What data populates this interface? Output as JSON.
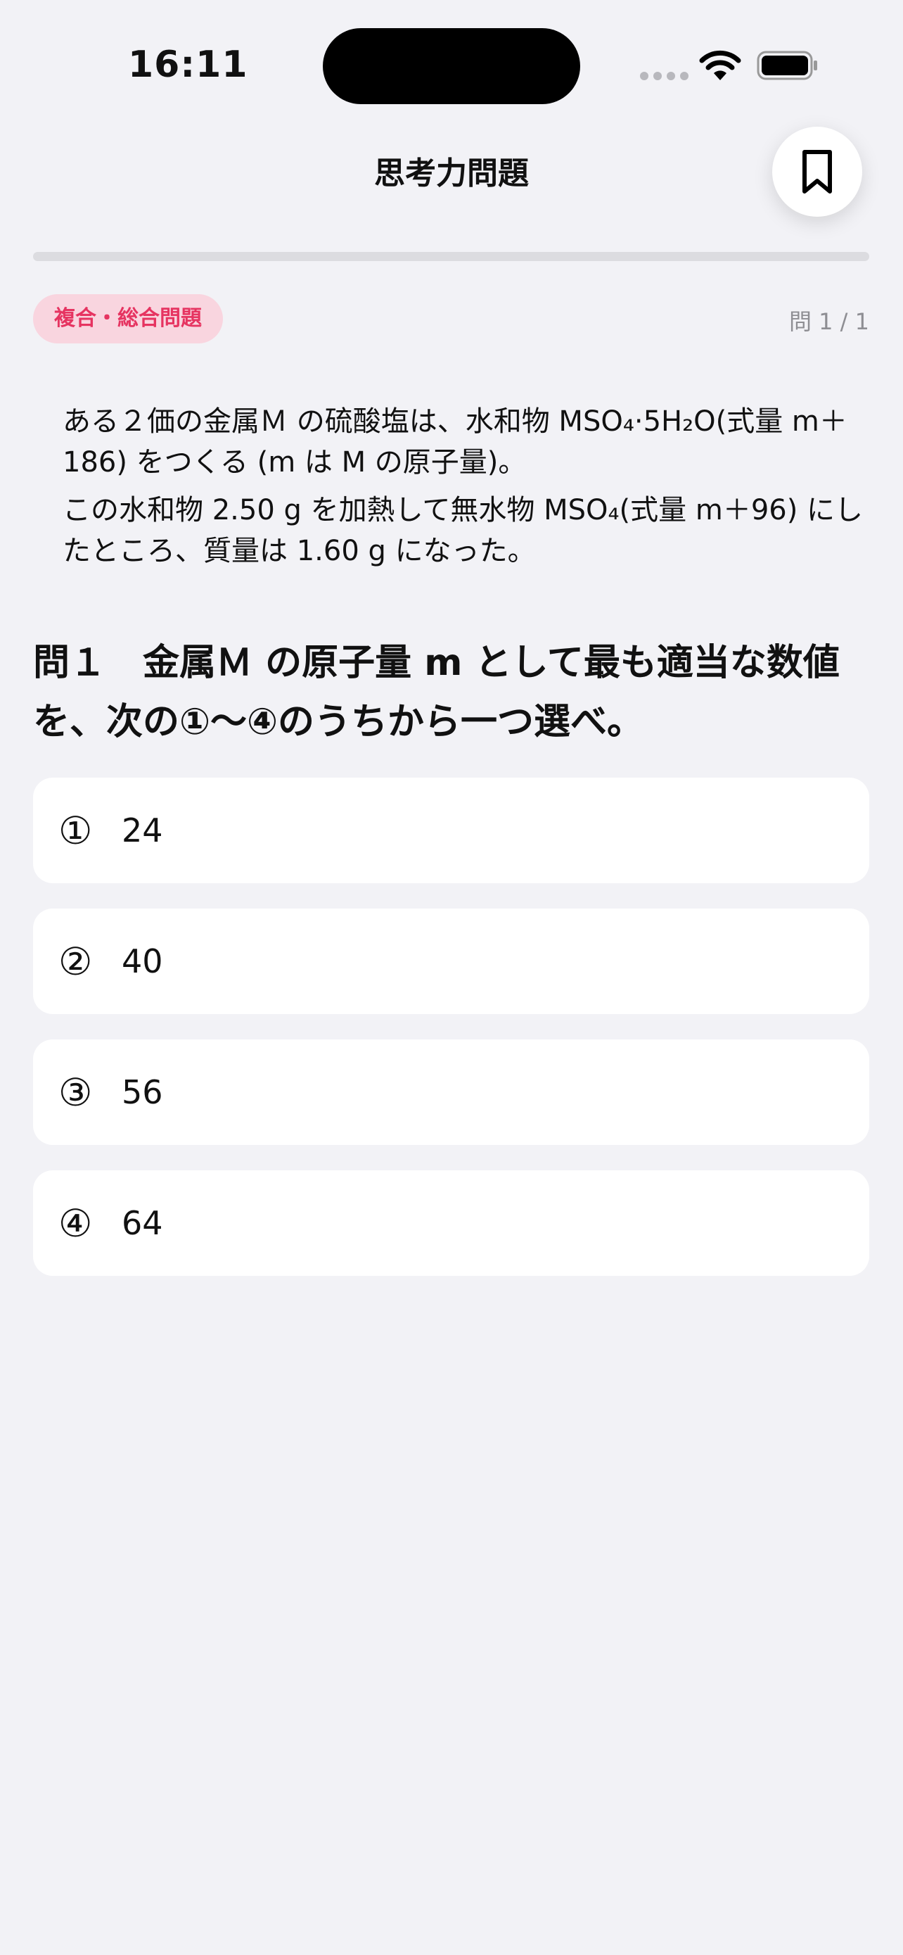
{
  "status": {
    "time": "16:11"
  },
  "nav": {
    "title": "思考力問題",
    "bookmark_icon": "bookmark-icon"
  },
  "progress": {
    "fraction": 0
  },
  "badge": {
    "label": "複合・総合問題",
    "color": "#E63461"
  },
  "counter": "問 1 / 1",
  "passage": [
    "ある２価の金属Ｍ の硫酸塩は、水和物 MSO₄·5H₂O(式量 m＋186) をつくる (m は M の原子量)。",
    "この水和物 2.50 g を加熱して無水物 MSO₄(式量 m＋96) にしたところ、質量は 1.60 g になった。"
  ],
  "question": "問１　金属Ｍ の原子量 m として最も適当な数値を、次の①〜④のうちから一つ選べ。",
  "choices": [
    {
      "number": "①",
      "value": "24"
    },
    {
      "number": "②",
      "value": "40"
    },
    {
      "number": "③",
      "value": "56"
    },
    {
      "number": "④",
      "value": "64"
    }
  ]
}
